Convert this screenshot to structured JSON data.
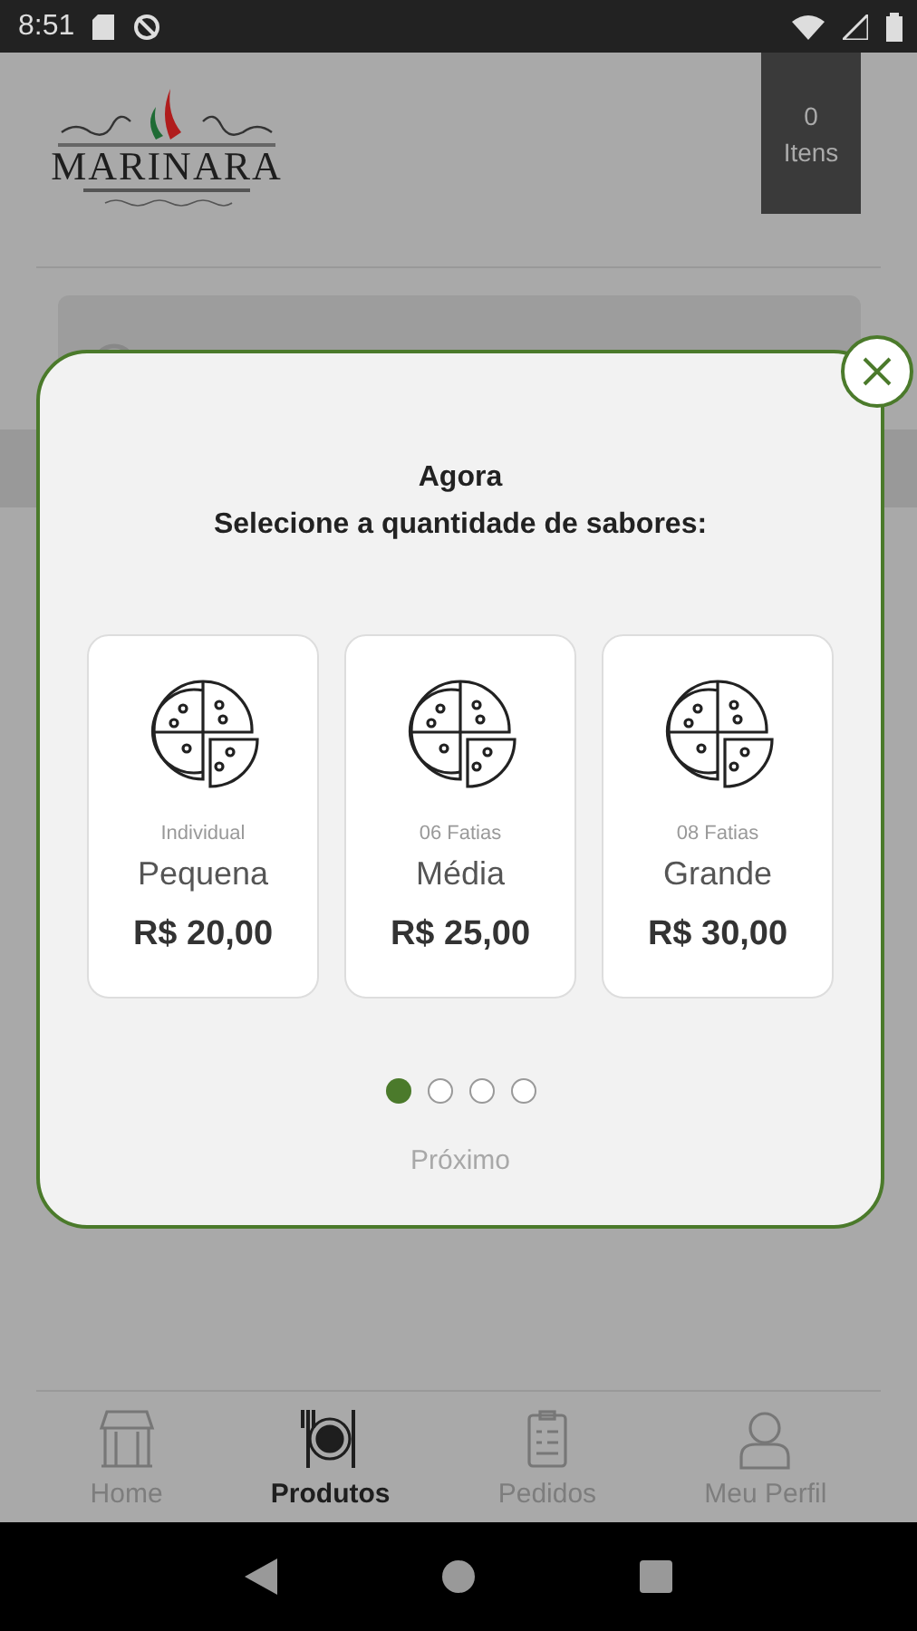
{
  "status_bar": {
    "time": "8:51"
  },
  "header": {
    "logo_text": "MARINARA",
    "cart": {
      "count": "0",
      "label": "Itens"
    }
  },
  "search": {
    "kind": "field"
  },
  "modal": {
    "title": "Agora",
    "subtitle": "Selecione a quantidade de sabores:",
    "options": [
      {
        "note": "Individual",
        "size": "Pequena",
        "price": "R$ 20,00"
      },
      {
        "note": "06 Fatias",
        "size": "Média",
        "price": "R$ 25,00"
      },
      {
        "note": "08 Fatias",
        "size": "Grande",
        "price": "R$ 30,00"
      }
    ],
    "steps": [
      {
        "selected": true
      },
      {
        "selected": false
      },
      {
        "selected": false
      },
      {
        "selected": false
      }
    ],
    "next_button": {
      "label": "Próximo",
      "disabled": true
    }
  },
  "bottom_nav": [
    {
      "kind": "store",
      "label": "Home",
      "selected": false
    },
    {
      "kind": "plate",
      "label": "Produtos",
      "selected": true
    },
    {
      "kind": "clipboard",
      "label": "Pedidos",
      "selected": false
    },
    {
      "kind": "person",
      "label": "Meu Perfil",
      "selected": false
    }
  ]
}
